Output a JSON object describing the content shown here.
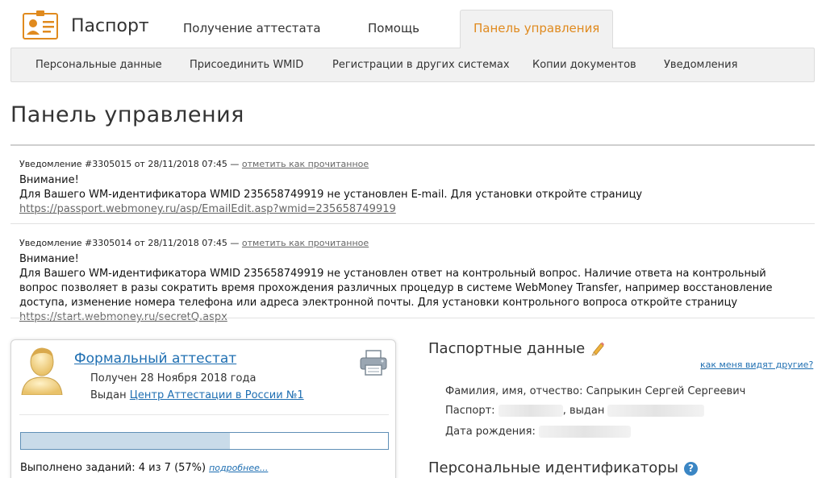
{
  "header": {
    "app_title": "Паспорт",
    "tabs": [
      {
        "label": "Получение аттестата"
      },
      {
        "label": "Помощь"
      },
      {
        "label": "Панель управления",
        "active": true
      }
    ],
    "accent_color": "#e08a1e"
  },
  "subnav": {
    "items": [
      {
        "label": "Персональные данные"
      },
      {
        "label": "Присоединить WMID"
      },
      {
        "label": "Регистрации в других системах"
      },
      {
        "label": "Копии документов"
      },
      {
        "label": "Уведомления"
      }
    ]
  },
  "page": {
    "title": "Панель управления"
  },
  "notifications": [
    {
      "header": "Уведомление #3305015 от 28/11/2018 07:45 —",
      "mark_read": "отметить как прочитанное",
      "attention": "Внимание!",
      "text": "Для Вашего WM-идентификатора WMID 235658749919 не установлен E-mail. Для установки откройте страницу",
      "link": "https://passport.webmoney.ru/asp/EmailEdit.asp?wmid=235658749919"
    },
    {
      "header": "Уведомление #3305014 от 28/11/2018 07:45 —",
      "mark_read": "отметить как прочитанное",
      "attention": "Внимание!",
      "text": "Для Вашего WM-идентификатора WMID 235658749919 не установлен ответ на контрольный вопрос. Наличие ответа на контрольный вопрос позволяет в разы сократить время прохождения различных процедур в системе WebMoney Transfer, например восстановление доступа, изменение номера телефона или адреса электронной почты. Для установки контрольного вопроса откройте страницу",
      "link": "https://start.webmoney.ru/secretQ.aspx"
    }
  ],
  "attestat": {
    "title": "Формальный аттестат",
    "received": "Получен 28 Ноября 2018 года",
    "issued_prefix": "Выдан",
    "issued_by": "Центр Аттестации в России №1",
    "progress_percent": 57,
    "tasks_text": "Выполнено заданий: 4 из 7 (57%)",
    "more_link": "подробнее..."
  },
  "passport_data": {
    "title": "Паспортные данные",
    "how_others_see": "как меня видят другие?",
    "full_name_label": "Фамилия, имя, отчество:",
    "full_name": "Сапрыкин Сергей Сергеевич",
    "passport_label": "Паспорт:",
    "issued_label": ", выдан",
    "birth_label": "Дата рождения:"
  },
  "identifiers": {
    "title": "Персональные идентификаторы",
    "help": "?"
  },
  "icons": {
    "logo": "id-card-icon",
    "avatar": "user-avatar-icon",
    "printer": "printer-icon",
    "edit": "pencil-icon",
    "help": "help-icon"
  }
}
